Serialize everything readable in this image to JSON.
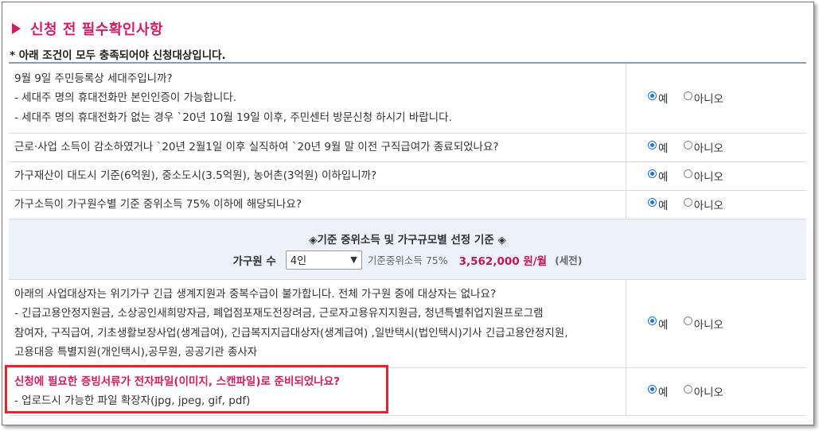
{
  "title": "신청 전 필수확인사항",
  "notice": "* 아래 조건이 모두 충족되어야 신청대상입니다.",
  "options": {
    "yes": "예",
    "no": "아니오"
  },
  "questions": [
    {
      "lines": [
        "9월 9일 주민등록상 세대주입니까?",
        "- 세대주 명의 휴대전화만 본인인증이 가능합니다.",
        "- 세대주 명의 휴대전화가 없는 경우 `20년 10월 19일 이후, 주민센터 방문신청 하시기 바랍니다."
      ],
      "answer": "예"
    },
    {
      "lines": [
        "근로·사업 소득이 감소하였거나 `20년 2월1일 이후 실직하여 `20년 9월 말 이전 구직급여가 종료되었나요?"
      ],
      "answer": "예"
    },
    {
      "lines": [
        "가구재산이 대도시 기준(6억원), 중소도시(3.5억원), 농어촌(3억원) 이하입니까?"
      ],
      "answer": "예"
    },
    {
      "lines": [
        "가구소득이 가구원수별 기준 중위소득 75% 이하에 해당되나요?"
      ],
      "answer": "예"
    },
    {
      "lines": [
        "아래의 사업대상자는 위기가구 긴급 생계지원과 중복수급이 불가합니다. 전체 가구원 중에 대상자는 없나요?",
        "- 긴급고용안정지원금, 소상공인새희망자금, 폐업점포재도전장려금, 근로자고용유지지원금, 청년특별취업지원프로그램",
        "참여자, 구직급여, 기초생활보장사업(생계급여), 긴급복지지급대상자(생계급여) ,일반택시(법인택시)기사 긴급고용안정지원,",
        "고용대응 특별지원(개인택시),공무원, 공공기관 종사자"
      ],
      "answer": "예"
    },
    {
      "lines": [
        "신청에 필요한 증빙서류가 전자파일(이미지, 스캔파일)로 준비되었나요?",
        "- 업로드시 가능한 파일 확장자(jpg, jpeg, gif, pdf)"
      ],
      "answer": "예"
    }
  ],
  "income_box": {
    "title": "◈기준 중위소득 및 가구규모별 선정 기준 ◈",
    "household_label": "가구원 수",
    "household_value": "4인",
    "standard_label": "기준중위소득 75%",
    "amount": "3,562,000 원/월",
    "tax_note": "(세전)"
  },
  "colors": {
    "accent": "#d81b60",
    "radio": "#1a73e8",
    "highlight": "#e8222f",
    "info_bg": "#edf2fa"
  },
  "icons": {
    "title_marker": "triangle-right-icon",
    "select_arrow": "chevron-down-icon"
  }
}
